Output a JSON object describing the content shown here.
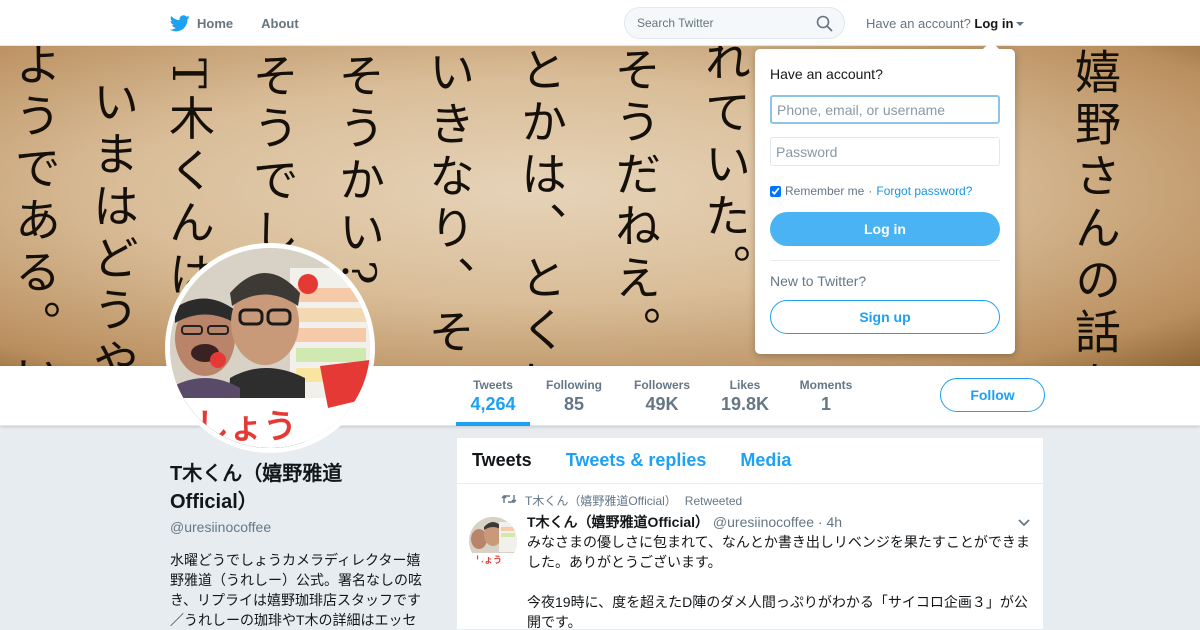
{
  "nav": {
    "home_label": "Home",
    "about_label": "About",
    "search_placeholder": "Search Twitter",
    "have_account_text": "Have an account?",
    "login_label": "Log in",
    "brand_color": "#1da1f2"
  },
  "banner": {
    "columns": [
      "嬉野さんの話を",
      "れていた。",
      "そうだねえ。",
      "とかは、とくに",
      "いきなり、その",
      "そうかい?",
      "そうでし",
      "T木くんは",
      "、いまはどうや",
      "ようである。いつ"
    ]
  },
  "profile": {
    "name": "T木くん（嬉野雅道Official）",
    "handle": "@uresiinocoffee",
    "bio": "水曜どうでしょうカメラディレクター嬉野雅道（うれしー）公式。署名なしの呟き、リプライは嬉野珈琲店スタッフです／うれしーの珈琲やT木の詳細はエッセ",
    "avatar_banner_text": "しょう"
  },
  "stats": [
    {
      "label": "Tweets",
      "value": "4,264"
    },
    {
      "label": "Following",
      "value": "85"
    },
    {
      "label": "Followers",
      "value": "49K"
    },
    {
      "label": "Likes",
      "value": "19.8K"
    },
    {
      "label": "Moments",
      "value": "1"
    }
  ],
  "follow_label": "Follow",
  "timeline": {
    "tabs": [
      "Tweets",
      "Tweets & replies",
      "Media"
    ],
    "tweet": {
      "retweet_by": "T木くん（嬉野雅道Official）",
      "retweet_word": "Retweeted",
      "author_name": "T木くん（嬉野雅道Official）",
      "author_handle": "@uresiinocoffee",
      "time": "· 4h",
      "text_1": "みなさまの優しさに包まれて、なんとか書き出しリベンジを果たすことができました。ありがとうございます。",
      "text_2": "今夜19時に、度を超えたD陣のダメ人間っぷりがわかる「サイコロ企画３」が公開です。"
    }
  },
  "login_panel": {
    "title": "Have an account?",
    "username_placeholder": "Phone, email, or username",
    "password_placeholder": "Password",
    "remember_label": "Remember me",
    "separator": "·",
    "forgot_label": "Forgot password?",
    "login_button": "Log in",
    "new_text": "New to Twitter?",
    "signup_button": "Sign up"
  }
}
